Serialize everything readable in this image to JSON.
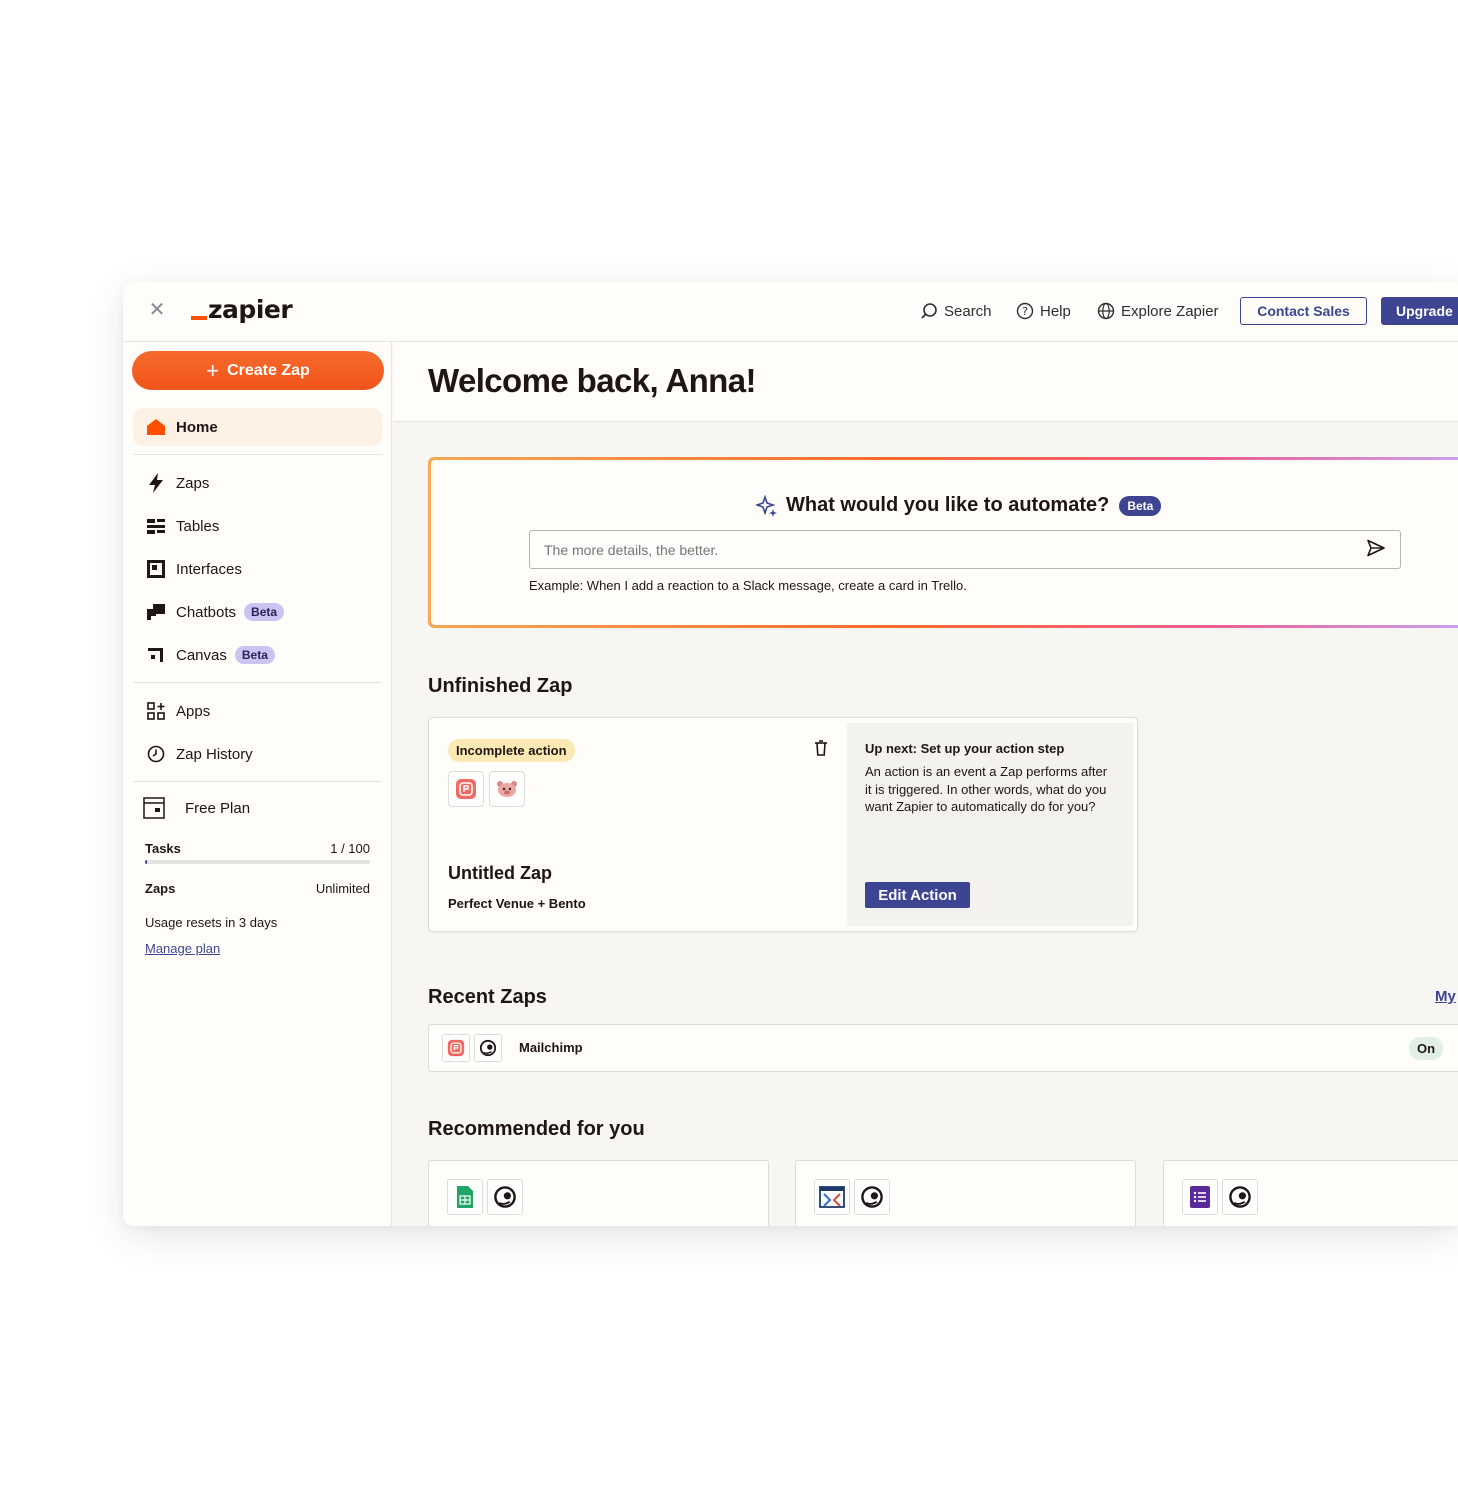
{
  "topbar": {
    "logo_text": "zapier",
    "search_label": "Search",
    "help_label": "Help",
    "explore_label": "Explore Zapier",
    "contact_sales_label": "Contact Sales",
    "upgrade_label": "Upgrade"
  },
  "sidebar": {
    "create_zap_label": "Create Zap",
    "home_label": "Home",
    "items": [
      {
        "label": "Zaps",
        "icon": "bolt-icon"
      },
      {
        "label": "Tables",
        "icon": "tables-icon"
      },
      {
        "label": "Interfaces",
        "icon": "interfaces-icon"
      },
      {
        "label": "Chatbots",
        "icon": "chatbots-icon",
        "badge": "Beta"
      },
      {
        "label": "Canvas",
        "icon": "canvas-icon",
        "badge": "Beta"
      },
      {
        "label": "Apps",
        "icon": "apps-icon"
      },
      {
        "label": "Zap History",
        "icon": "clock-icon"
      }
    ],
    "plan": {
      "title": "Free Plan",
      "tasks_label": "Tasks",
      "tasks_value": "1 / 100",
      "tasks_used_fraction": 0.01,
      "zaps_label": "Zaps",
      "zaps_value": "Unlimited",
      "reset_text": "Usage resets in 3 days",
      "manage_label": "Manage plan"
    }
  },
  "main": {
    "welcome": "Welcome back, Anna!",
    "ai": {
      "title": "What would you like to automate?",
      "badge": "Beta",
      "placeholder": "The more details, the better.",
      "example": "Example: When I add a reaction to a Slack message, create a card in Trello."
    },
    "unfinished": {
      "section_title": "Unfinished Zap",
      "badge": "Incomplete action",
      "zap_name": "Untitled Zap",
      "apps": "Perfect Venue + Bento",
      "next_title": "Up next: Set up your action step",
      "next_body": "An action is an event a Zap performs after it is triggered. In other words, what do you want Zapier to automatically do for you?",
      "edit_label": "Edit Action"
    },
    "recent": {
      "section_title": "Recent Zaps",
      "link_label": "My",
      "row_name": "Mailchimp",
      "status": "On"
    },
    "recommended": {
      "section_title": "Recommended for you"
    }
  },
  "colors": {
    "brand_orange": "#ff4f00",
    "primary_blue": "#3d4592",
    "beta_purple": "#c9c4f2"
  }
}
